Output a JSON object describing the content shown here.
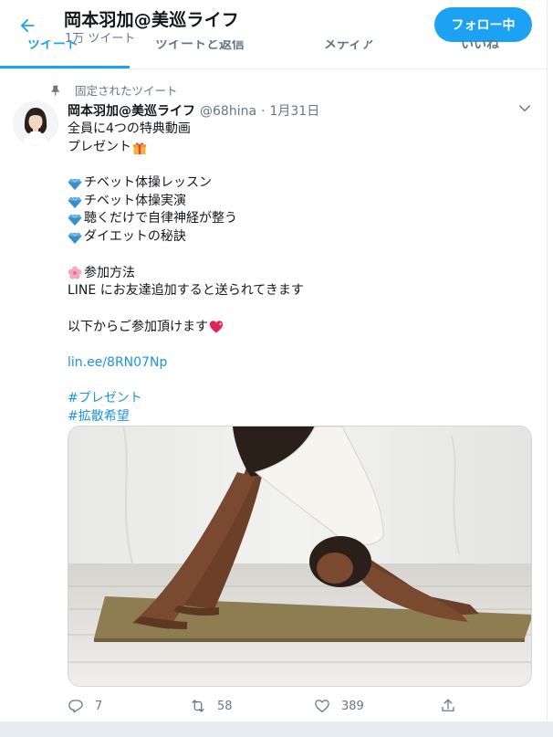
{
  "header": {
    "title": "岡本羽加@美巡ライフ",
    "subtitle": "1万 ツイート",
    "follow_label": "フォロー中"
  },
  "tabs": [
    {
      "label": "ツイート",
      "active": true
    },
    {
      "label": "ツイートと返信",
      "active": false
    },
    {
      "label": "メディア",
      "active": false
    },
    {
      "label": "いいね",
      "active": false
    }
  ],
  "tweet": {
    "pinned_label": "固定されたツイート",
    "name": "岡本羽加@美巡ライフ",
    "handle": "@68hina",
    "separator": "·",
    "date": "1月31日",
    "lines": {
      "l1": "全員に4つの特典動画",
      "l2": "プレゼント",
      "l3": "チベット体操レッスン",
      "l4": "チベット体操実演",
      "l5": "聴くだけで自律神経が整う",
      "l6": "ダイエットの秘訣",
      "l7": "参加方法",
      "l8": "LINE にお友達追加すると送られてきます",
      "l9": "以下からご参加頂けます",
      "link": "lin.ee/8RN07Np",
      "tag1": "#プレゼント",
      "tag2": "#拡散希望"
    },
    "stats": {
      "replies": "7",
      "retweets": "58",
      "likes": "389"
    }
  },
  "icons": {
    "back": "arrow-left-icon",
    "pin": "pin-icon",
    "caret": "chevron-down-icon",
    "gift": "gift-emoji",
    "gem": "gem-emoji",
    "flower": "cherry-blossom-emoji",
    "heart": "sparkling-heart-emoji",
    "reply": "reply-icon",
    "retweet": "retweet-icon",
    "like": "heart-icon",
    "share": "share-icon"
  },
  "colors": {
    "accent": "#1da1f2",
    "link": "#1b95e0",
    "muted": "#657786",
    "text": "#14171a",
    "border": "#e6ecf0"
  }
}
